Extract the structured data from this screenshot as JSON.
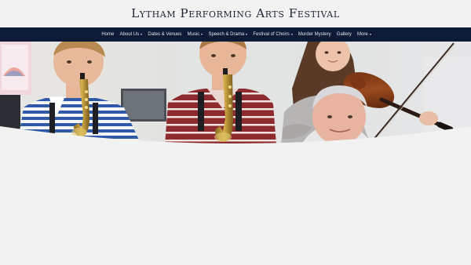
{
  "site": {
    "title": "Lytham Performing Arts Festival"
  },
  "nav": {
    "items": [
      {
        "label": "Home",
        "has_dropdown": false
      },
      {
        "label": "About Us",
        "has_dropdown": true
      },
      {
        "label": "Dates & Venues",
        "has_dropdown": false
      },
      {
        "label": "Music",
        "has_dropdown": true
      },
      {
        "label": "Speech & Drama",
        "has_dropdown": true
      },
      {
        "label": "Festival of Choirs",
        "has_dropdown": true
      },
      {
        "label": "Murder Mystery",
        "has_dropdown": false
      },
      {
        "label": "Gallery",
        "has_dropdown": false
      },
      {
        "label": "More",
        "has_dropdown": true
      }
    ]
  },
  "hero": {
    "subject": "young musicians performing: two saxophonists, a violinist and an accompanist"
  },
  "colors": {
    "page_background": "#f2f2f2",
    "nav_background": "#0d1b36",
    "nav_text": "#e4e8f0",
    "title_text": "#1b2433"
  }
}
